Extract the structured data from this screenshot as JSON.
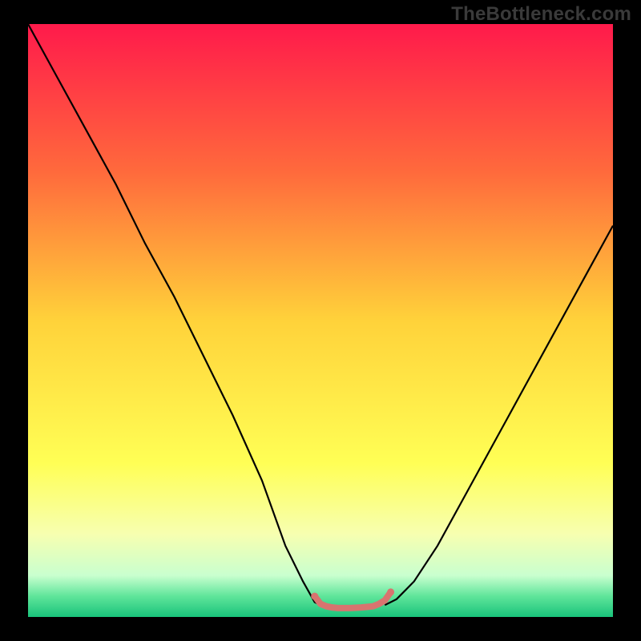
{
  "watermark": "TheBottleneck.com",
  "chart_data": {
    "type": "line",
    "title": "",
    "xlabel": "",
    "ylabel": "",
    "xlim": [
      0,
      100
    ],
    "ylim": [
      0,
      100
    ],
    "grid": false,
    "legend": false,
    "background_gradient": {
      "direction": "vertical",
      "stops": [
        {
          "offset": 0.0,
          "color": "#ff1a4b"
        },
        {
          "offset": 0.25,
          "color": "#ff6a3c"
        },
        {
          "offset": 0.5,
          "color": "#ffd23a"
        },
        {
          "offset": 0.74,
          "color": "#ffff55"
        },
        {
          "offset": 0.86,
          "color": "#f7ffb0"
        },
        {
          "offset": 0.93,
          "color": "#c9ffcf"
        },
        {
          "offset": 0.965,
          "color": "#5fe59a"
        },
        {
          "offset": 1.0,
          "color": "#19c37b"
        }
      ]
    },
    "series": [
      {
        "name": "left-branch",
        "type": "line",
        "color": "#000000",
        "width": 2.2,
        "x": [
          0,
          5,
          10,
          15,
          20,
          25,
          30,
          35,
          40,
          44,
          47,
          49,
          50
        ],
        "y": [
          100,
          91,
          82,
          73,
          63,
          54,
          44,
          34,
          23,
          12,
          6,
          2.5,
          2
        ]
      },
      {
        "name": "right-branch",
        "type": "line",
        "color": "#000000",
        "width": 2.2,
        "x": [
          61,
          63,
          66,
          70,
          75,
          80,
          85,
          90,
          95,
          100
        ],
        "y": [
          2,
          3,
          6,
          12,
          21,
          30,
          39,
          48,
          57,
          66
        ]
      },
      {
        "name": "bottom-band",
        "type": "line",
        "color": "#d8746f",
        "width": 8,
        "linecap": "round",
        "x": [
          49,
          50,
          51,
          52,
          53,
          55,
          57,
          59,
          60,
          61,
          62
        ],
        "y": [
          3.5,
          2.2,
          1.8,
          1.6,
          1.5,
          1.5,
          1.6,
          1.8,
          2.2,
          2.8,
          4.2
        ]
      }
    ],
    "markers": [
      {
        "name": "left-end-dot",
        "x": 49,
        "y": 3.5,
        "r": 4.5,
        "color": "#d8746f"
      },
      {
        "name": "right-end-dot",
        "x": 62,
        "y": 4.2,
        "r": 4.5,
        "color": "#d8746f"
      }
    ]
  }
}
